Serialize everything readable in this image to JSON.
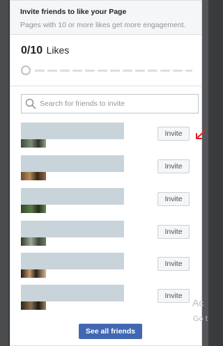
{
  "header": {
    "title": "Invite friends to like your Page",
    "subtitle": "Pages with 10 or more likes get more engagement."
  },
  "likes": {
    "count": "0/10",
    "label": "Likes",
    "progress_fraction": 0
  },
  "search": {
    "placeholder": "Search for friends to invite",
    "value": ""
  },
  "friends": [
    {
      "invite_label": "Invite"
    },
    {
      "invite_label": "Invite"
    },
    {
      "invite_label": "Invite"
    },
    {
      "invite_label": "Invite"
    },
    {
      "invite_label": "Invite"
    },
    {
      "invite_label": "Invite"
    }
  ],
  "footer": {
    "see_all_label": "See all friends"
  },
  "watermark": {
    "line1": "Ac",
    "line2": "Go t"
  },
  "colors": {
    "primary_button": "#4267b2",
    "annotation_arrow": "#e41e1e",
    "redacted_name": "#c8d3da"
  },
  "icons": [
    "search-icon",
    "red-arrow-annotation"
  ]
}
